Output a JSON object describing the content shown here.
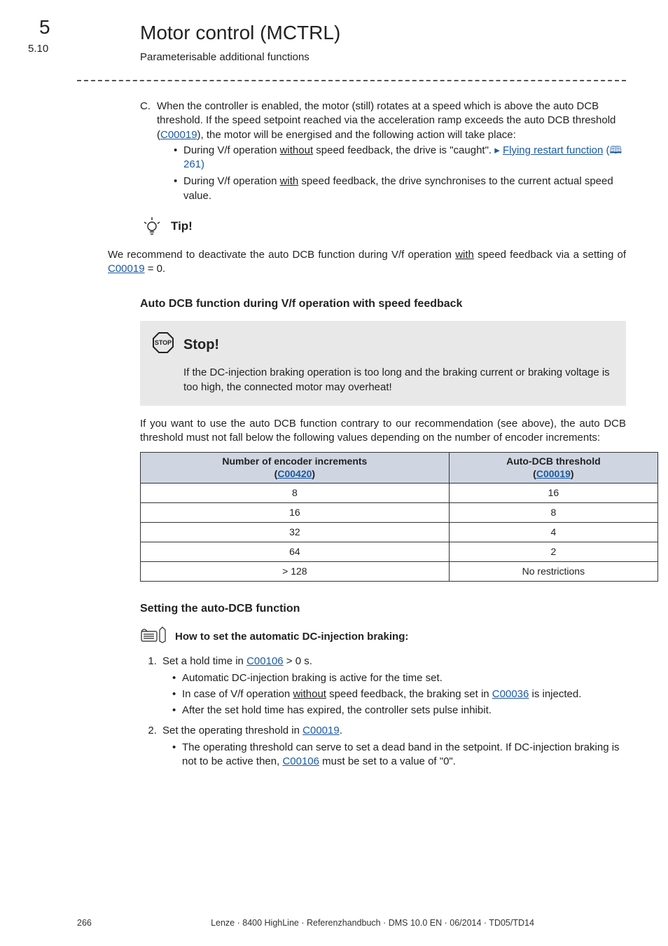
{
  "chapter": {
    "number": "5",
    "title": "Motor control (MCTRL)"
  },
  "section": {
    "number": "5.10",
    "title": "Parameterisable additional functions"
  },
  "listC": {
    "letter": "C.",
    "text_a": "When the controller is enabled, the motor (still) rotates at a speed which is above the auto DCB threshold. If the speed setpoint reached via the acceleration ramp exceeds the auto DCB threshold (",
    "link1": "C00019",
    "text_b": "), the motor will be energised and the following action will take place:",
    "b1_a": "During V/f operation ",
    "b1_u": "without",
    "b1_b": " speed feedback, the drive is \"caught\". ",
    "b1_link": "Flying restart function",
    "b1_page": "261",
    "b2_a": "During V/f operation ",
    "b2_u": "with",
    "b2_b": " speed feedback, the drive synchronises to the current actual speed value."
  },
  "tip": {
    "head": "Tip!",
    "body_a": "We recommend to deactivate the auto DCB function during V/f operation ",
    "body_u": "with",
    "body_b": " speed feedback via a setting of ",
    "link": "C00019",
    "body_c": " = 0."
  },
  "subheading1": "Auto DCB function during V/f operation with speed feedback",
  "stop": {
    "title": "Stop!",
    "body": "If the DC-injection braking operation is too long and the braking current or braking voltage is too high, the connected motor may overheat!"
  },
  "para1": "If you want to use the auto DCB function contrary to our recommendation (see above), the auto DCB threshold must not fall below the following values depending on the number of encoder increments:",
  "table": {
    "h1a": "Number of encoder increments",
    "h1b": "C00420",
    "h2a": "Auto-DCB threshold",
    "h2b": "C00019",
    "rows": [
      {
        "c1": "8",
        "c2": "16"
      },
      {
        "c1": "16",
        "c2": "8"
      },
      {
        "c1": "32",
        "c2": "4"
      },
      {
        "c1": "64",
        "c2": "2"
      },
      {
        "c1": "> 128",
        "c2": "No restrictions"
      }
    ]
  },
  "subheading2": "Setting the auto-DCB function",
  "howto": {
    "head": "How to set the automatic DC-injection braking:",
    "s1_a": "Set a hold time in ",
    "s1_link": "C00106",
    "s1_b": " > 0 s.",
    "s1_sub1": "Automatic DC-injection braking is active for the time set.",
    "s1_sub2_a": "In case of V/f operation ",
    "s1_sub2_u": "without",
    "s1_sub2_b": " speed feedback, the braking set in ",
    "s1_sub2_link": "C00036",
    "s1_sub2_c": " is injected.",
    "s1_sub3": "After the set hold time has expired, the controller sets pulse inhibit.",
    "s2_a": "Set the operating threshold in ",
    "s2_link": "C00019",
    "s2_b": ".",
    "s2_sub1_a": "The operating threshold can serve to set a dead band in the setpoint. If DC-injection braking is not to be active then, ",
    "s2_sub1_link": "C00106",
    "s2_sub1_b": " must be set to a value of \"0\"."
  },
  "footer": {
    "page": "266",
    "text": "Lenze · 8400 HighLine · Referenzhandbuch · DMS 10.0 EN · 06/2014 · TD05/TD14"
  }
}
